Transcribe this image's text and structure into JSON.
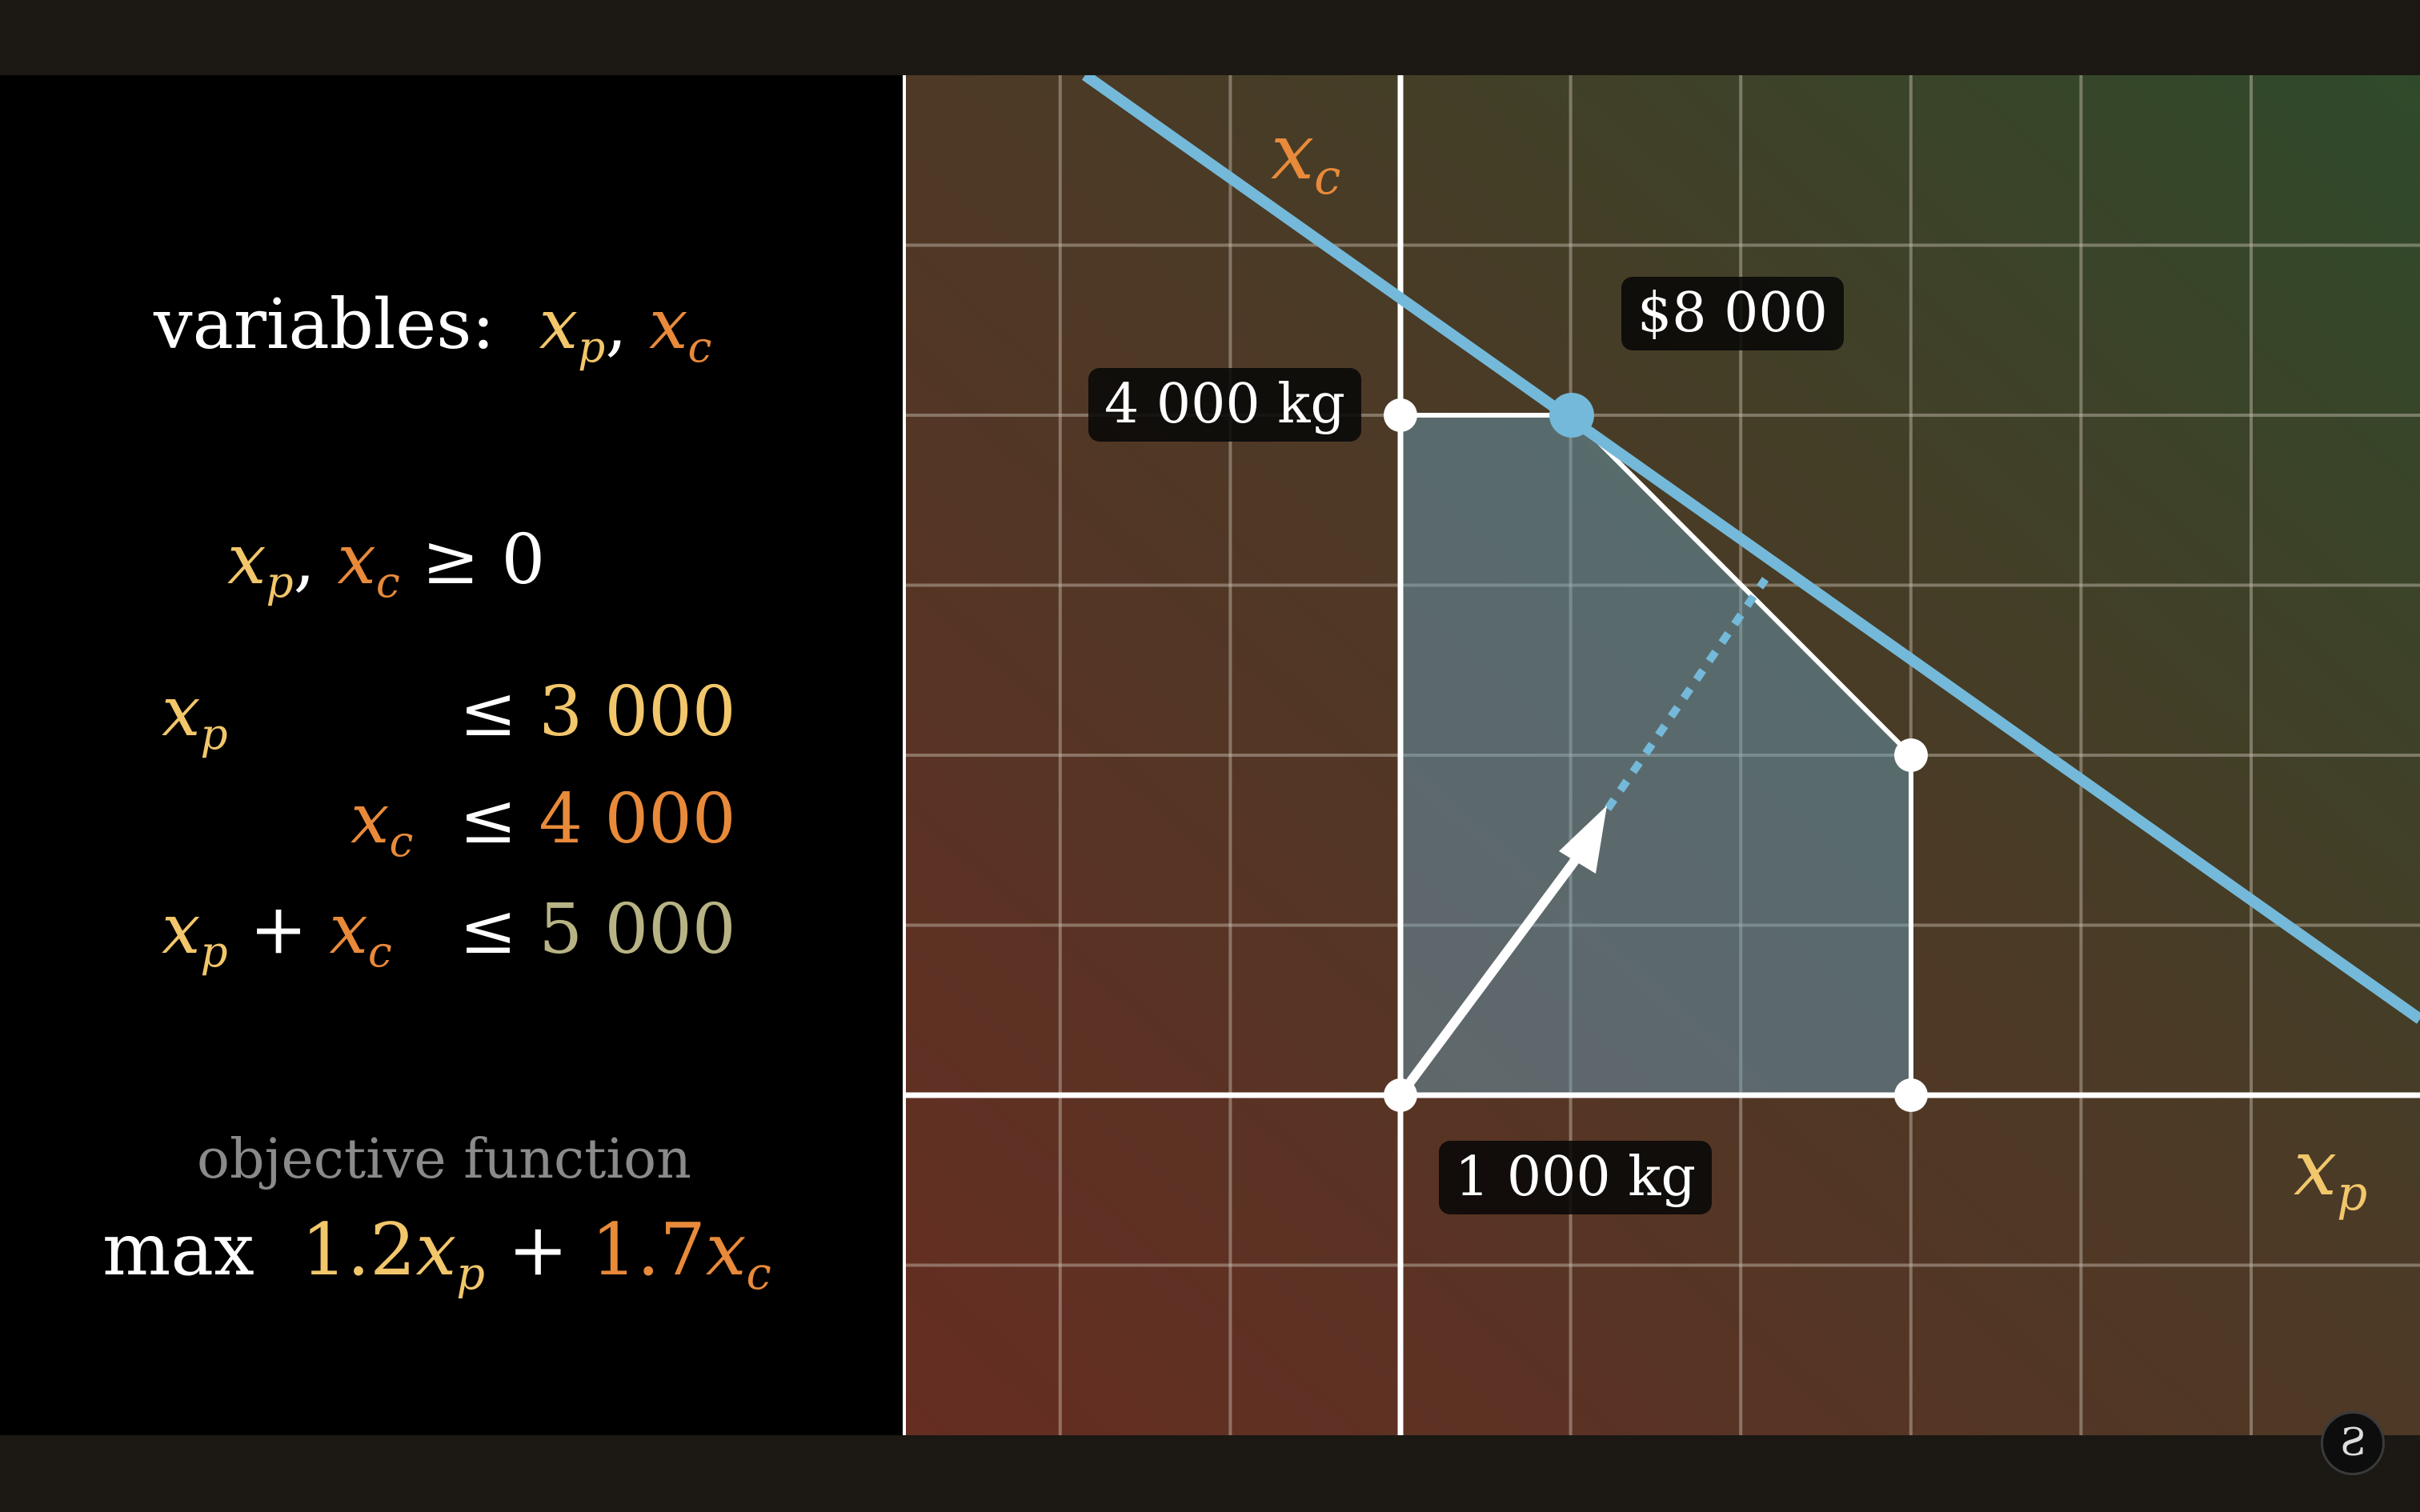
{
  "left": {
    "variables_label": "variables:",
    "var_p": "x",
    "var_p_sub": "p",
    "var_c": "x",
    "var_c_sub": "c",
    "nonneg_rhs": "≥ 0",
    "constraint1_rhs": "3 000",
    "constraint2_rhs": "4 000",
    "constraint3_rhs": "5 000",
    "leq": "≤",
    "plus": "+",
    "comma": ",",
    "objective_caption": "objective function",
    "objective_max": "max",
    "coef_p": "1.2",
    "coef_c": "1.7"
  },
  "plot": {
    "axis_label_x": "x",
    "axis_label_x_sub": "p",
    "axis_label_y": "x",
    "axis_label_y_sub": "c",
    "label_4000kg": "4 000 kg",
    "label_1000kg": "1 000 kg",
    "label_profit": "$8 000",
    "colors": {
      "accent_blue": "#74b9d9",
      "region_fill": "#6aa7c4",
      "p_color": "#f2c66b",
      "c_color": "#e88a3a",
      "sum_color": "#b8b384"
    }
  },
  "logo": {
    "glyph": "Ƨ"
  }
}
